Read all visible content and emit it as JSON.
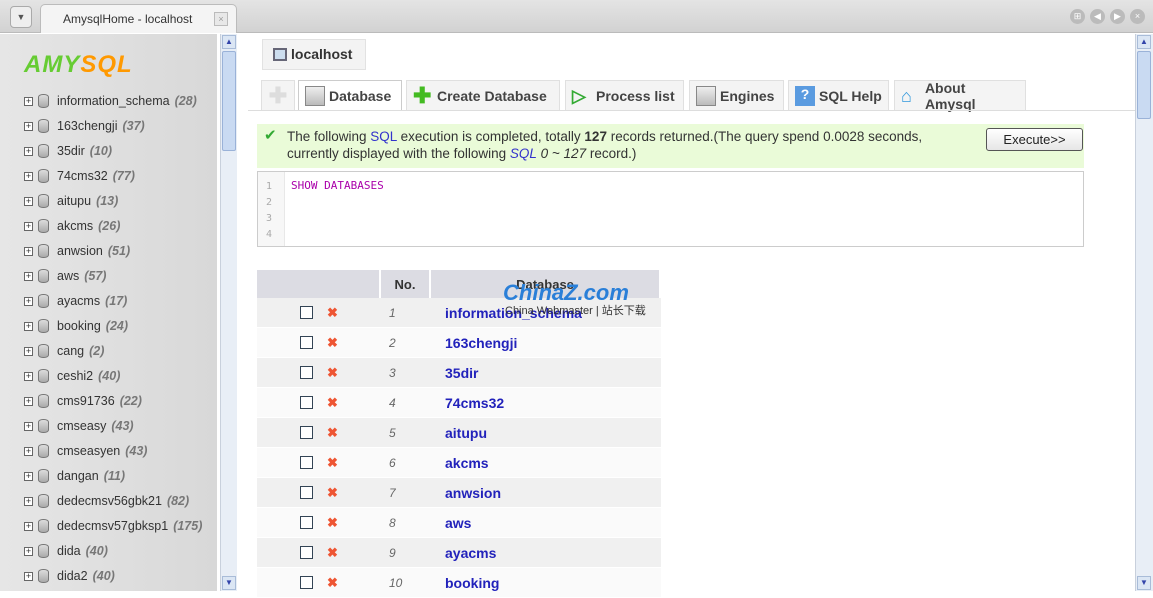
{
  "browser": {
    "tab_title": "AmysqlHome - localhost"
  },
  "sidebar": {
    "logo": "AMYSQL",
    "databases": [
      {
        "name": "information_schema",
        "count": "(28)"
      },
      {
        "name": "163chengji",
        "count": "(37)"
      },
      {
        "name": "35dir",
        "count": "(10)"
      },
      {
        "name": "74cms32",
        "count": "(77)"
      },
      {
        "name": "aitupu",
        "count": "(13)"
      },
      {
        "name": "akcms",
        "count": "(26)"
      },
      {
        "name": "anwsion",
        "count": "(51)"
      },
      {
        "name": "aws",
        "count": "(57)"
      },
      {
        "name": "ayacms",
        "count": "(17)"
      },
      {
        "name": "booking",
        "count": "(24)"
      },
      {
        "name": "cang",
        "count": "(2)"
      },
      {
        "name": "ceshi2",
        "count": "(40)"
      },
      {
        "name": "cms91736",
        "count": "(22)"
      },
      {
        "name": "cmseasy",
        "count": "(43)"
      },
      {
        "name": "cmseasyen",
        "count": "(43)"
      },
      {
        "name": "dangan",
        "count": "(11)"
      },
      {
        "name": "dedecmsv56gbk21",
        "count": "(82)"
      },
      {
        "name": "dedecmsv57gbksp1",
        "count": "(175)"
      },
      {
        "name": "dida",
        "count": "(40)"
      },
      {
        "name": "dida2",
        "count": "(40)"
      }
    ]
  },
  "host": "localhost",
  "tabs": [
    "Database",
    "Create Database",
    "Process list",
    "Engines",
    "SQL Help",
    "About Amysql"
  ],
  "message": {
    "p1": "The following ",
    "sql": "SQL",
    "p2": " execution is completed, totally ",
    "total": "127",
    "p3": " records returned.(The query spend 0.0028 seconds,",
    "p4": "currently displayed with the following ",
    "range": "0 ~ 127",
    "p5": " record.)"
  },
  "execute_label": "Execute>>",
  "editor": {
    "lines": [
      "1",
      "2",
      "3",
      "4"
    ],
    "code": "SHOW DATABASES"
  },
  "table": {
    "headers": [
      "No.",
      "Database"
    ],
    "rows": [
      {
        "no": "1",
        "name": "information_schema"
      },
      {
        "no": "2",
        "name": "163chengji"
      },
      {
        "no": "3",
        "name": "35dir"
      },
      {
        "no": "4",
        "name": "74cms32"
      },
      {
        "no": "5",
        "name": "aitupu"
      },
      {
        "no": "6",
        "name": "akcms"
      },
      {
        "no": "7",
        "name": "anwsion"
      },
      {
        "no": "8",
        "name": "aws"
      },
      {
        "no": "9",
        "name": "ayacms"
      },
      {
        "no": "10",
        "name": "booking"
      }
    ]
  },
  "watermark": {
    "logo": "ChinaZ.com",
    "sub": "China Webmaster | 站长下载"
  }
}
